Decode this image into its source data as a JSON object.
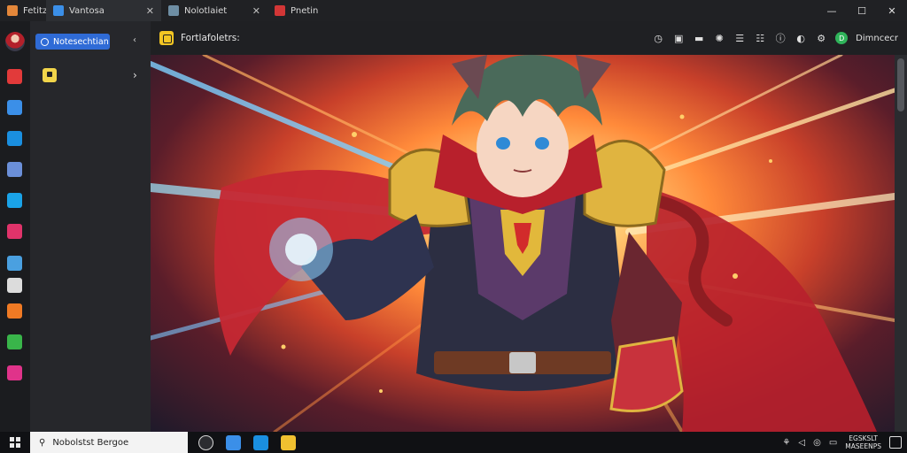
{
  "tabs": [
    {
      "label": "Fetitz",
      "fav_color": "#e4873a"
    },
    {
      "label": "Vantosa",
      "fav_color": "#3b8fe8"
    },
    {
      "label": "Nolotlaiet",
      "fav_color": "#6e8ea4"
    },
    {
      "label": "Pnetin",
      "fav_color": "#d23636"
    }
  ],
  "tab_close_glyph": "✕",
  "window_controls": {
    "minimize": "—",
    "maximize": "☐",
    "close": "✕"
  },
  "sidebar": {
    "profile_button": "Notesechtian",
    "apps": [
      {
        "icon": "red-shield-icon",
        "color": "#e23a3a"
      },
      {
        "icon": "document-icon",
        "color": "#3b8fe8"
      },
      {
        "icon": "edge-icon",
        "color": "#1a8fe0"
      },
      {
        "icon": "file-icon",
        "color": "#6b8fd8"
      },
      {
        "icon": "blue-app-icon",
        "color": "#1aa3e8"
      },
      {
        "icon": "pink-app-icon",
        "color": "#e0336a"
      },
      {
        "icon": "monitor-icon",
        "color": "#4aa0e0"
      },
      {
        "icon": "list-icon",
        "color": "#dcdcdc"
      },
      {
        "icon": "orange-app-icon",
        "color": "#f07a24"
      },
      {
        "icon": "green-app-icon",
        "color": "#39b54a"
      },
      {
        "icon": "magenta-app-icon",
        "color": "#e0338a"
      }
    ]
  },
  "toolbar": {
    "page_title": "Fortlafoletrs:",
    "user_name": "Dimncecr",
    "user_initial": "D"
  },
  "taskbar": {
    "search_placeholder": "Nobolstst Bergoe",
    "apps": [
      {
        "icon": "chat-icon",
        "color": "#2b2c30"
      },
      {
        "icon": "file-explorer-icon",
        "color": "#3b8fe8"
      },
      {
        "icon": "store-icon",
        "color": "#1a8fe0"
      },
      {
        "icon": "game-icon",
        "color": "#f0c030"
      }
    ],
    "clock_line1": "EGSKSLT",
    "clock_line2": "MASEENPS"
  }
}
